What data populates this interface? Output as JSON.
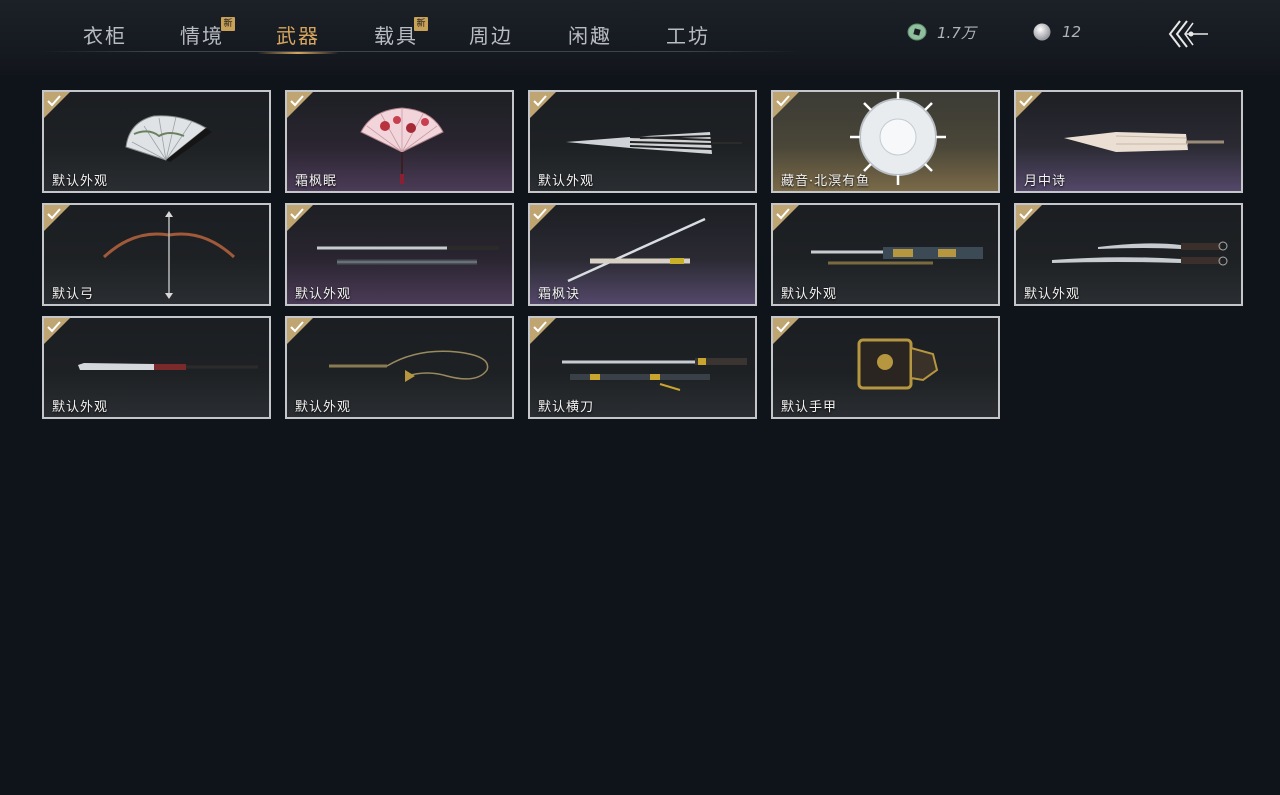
{
  "tabs": [
    {
      "label": "衣柜",
      "active": false,
      "new": false
    },
    {
      "label": "情境",
      "active": false,
      "new": true
    },
    {
      "label": "武器",
      "active": true,
      "new": false
    },
    {
      "label": "载具",
      "active": false,
      "new": true
    },
    {
      "label": "周边",
      "active": false,
      "new": false
    },
    {
      "label": "闲趣",
      "active": false,
      "new": false
    },
    {
      "label": "工坊",
      "active": false,
      "new": false
    }
  ],
  "new_badge": "新",
  "currency": {
    "coins": {
      "icon": "jade-coin-icon",
      "value": "1.7万"
    },
    "pearls": {
      "icon": "pearl-icon",
      "value": "12"
    }
  },
  "items": [
    {
      "label": "默认外观",
      "icon": "folding-fan-icon",
      "owned": true
    },
    {
      "label": "霜枫眠",
      "icon": "maple-fan-icon",
      "owned": true
    },
    {
      "label": "默认外观",
      "icon": "umbrella-icon",
      "owned": true
    },
    {
      "label": "藏音·北溟有鱼",
      "icon": "shell-umbrella-icon",
      "owned": true
    },
    {
      "label": "月中诗",
      "icon": "paper-umbrella-icon",
      "owned": true
    },
    {
      "label": "默认弓",
      "icon": "bow-icon",
      "owned": true
    },
    {
      "label": "默认外观",
      "icon": "spear-pair-icon",
      "owned": true
    },
    {
      "label": "霜枫诀",
      "icon": "sword-icon",
      "owned": true
    },
    {
      "label": "默认外观",
      "icon": "ornate-blade-icon",
      "owned": true
    },
    {
      "label": "默认外观",
      "icon": "twin-sabres-icon",
      "owned": true
    },
    {
      "label": "默认外观",
      "icon": "glaive-icon",
      "owned": true
    },
    {
      "label": "默认外观",
      "icon": "rope-dart-icon",
      "owned": true
    },
    {
      "label": "默认横刀",
      "icon": "hengdao-icon",
      "owned": true
    },
    {
      "label": "默认手甲",
      "icon": "gauntlet-icon",
      "owned": true
    }
  ],
  "colors": {
    "accent": "#d6a65e",
    "badge": "#c9a25a",
    "check": "#bfa572",
    "background": "#0f131a"
  }
}
